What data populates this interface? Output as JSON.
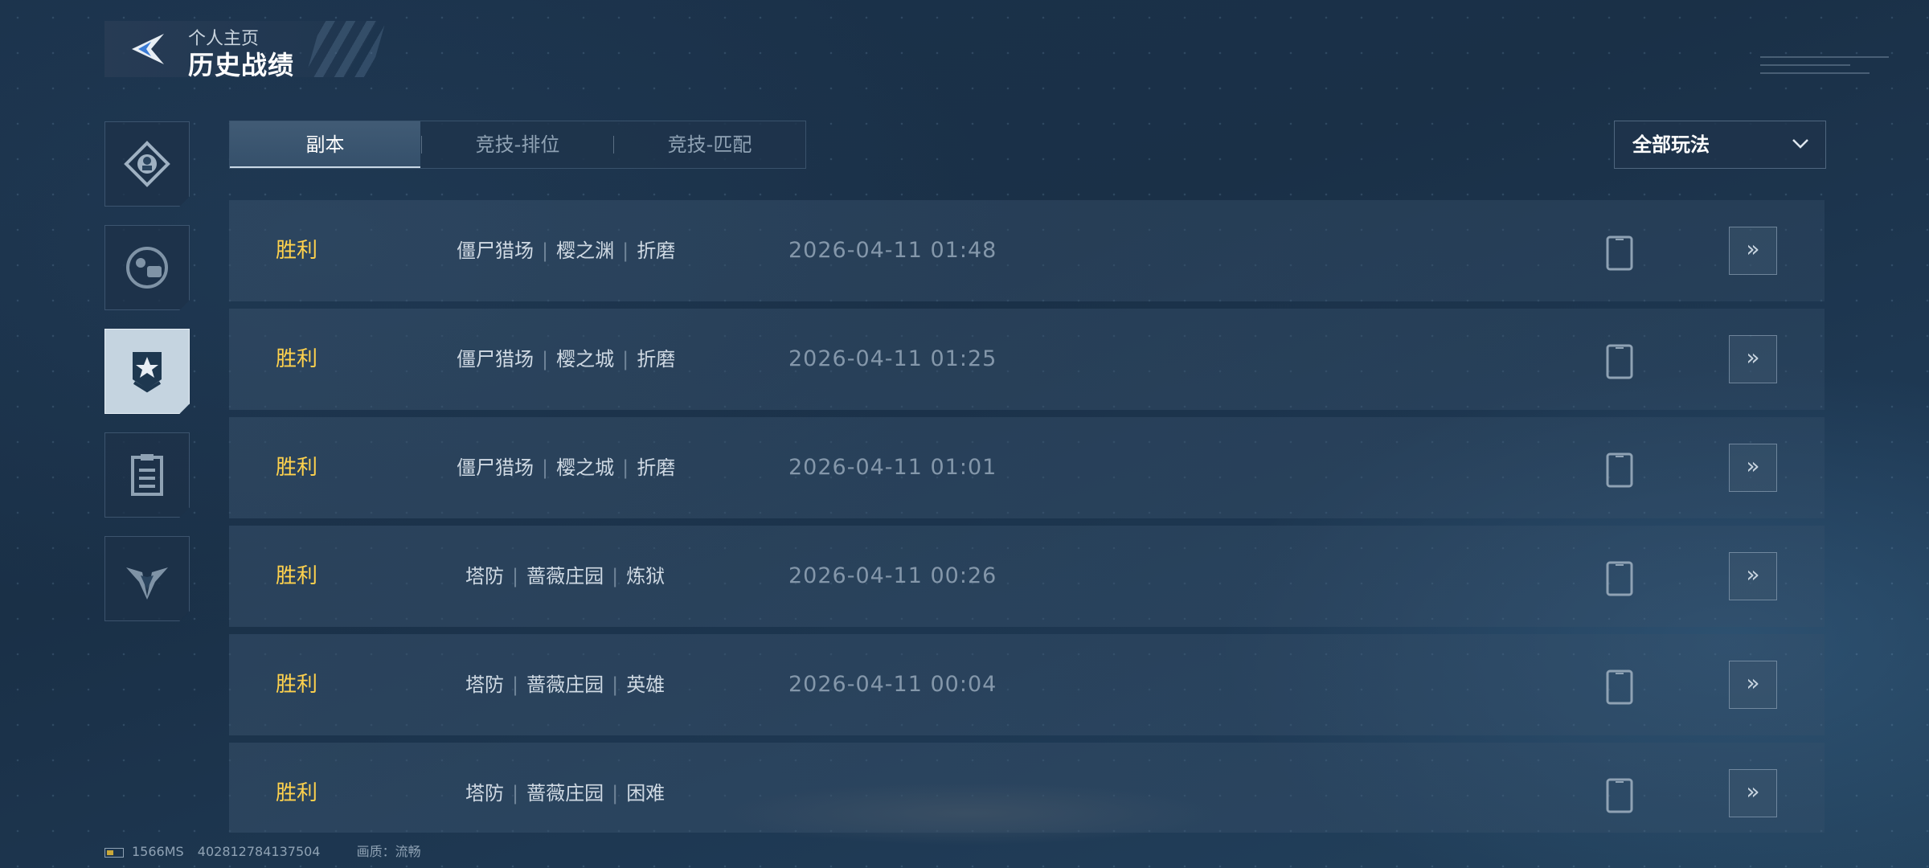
{
  "header": {
    "breadcrumb": "个人主页",
    "title": "历史战绩"
  },
  "sidebar": {
    "items": [
      {
        "icon": "profile-badge-icon",
        "active": false
      },
      {
        "icon": "team-icon",
        "active": false
      },
      {
        "icon": "rank-star-icon",
        "active": true
      },
      {
        "icon": "clipboard-icon",
        "active": false
      },
      {
        "icon": "emblem-icon",
        "active": false
      }
    ]
  },
  "tabs": [
    {
      "label": "副本",
      "active": true
    },
    {
      "label": "竞技-排位",
      "active": false
    },
    {
      "label": "竞技-匹配",
      "active": false
    }
  ],
  "filter": {
    "label": "全部玩法"
  },
  "records": [
    {
      "result": "胜利",
      "mode": "僵尸猎场",
      "map": "樱之渊",
      "difficulty": "折磨",
      "time": "2026-04-11 01:48"
    },
    {
      "result": "胜利",
      "mode": "僵尸猎场",
      "map": "樱之城",
      "difficulty": "折磨",
      "time": "2026-04-11 01:25"
    },
    {
      "result": "胜利",
      "mode": "僵尸猎场",
      "map": "樱之城",
      "difficulty": "折磨",
      "time": "2026-04-11 01:01"
    },
    {
      "result": "胜利",
      "mode": "塔防",
      "map": "蔷薇庄园",
      "difficulty": "炼狱",
      "time": "2026-04-11 00:26"
    },
    {
      "result": "胜利",
      "mode": "塔防",
      "map": "蔷薇庄园",
      "difficulty": "英雄",
      "time": "2026-04-11 00:04"
    },
    {
      "result": "胜利",
      "mode": "塔防",
      "map": "蔷薇庄园",
      "difficulty": "困难",
      "time": ""
    }
  ],
  "footer": {
    "ping": "1566MS",
    "uid": "402812784137504",
    "quality": "画质：流畅"
  },
  "colors": {
    "victory": "#ffd24d",
    "accent": "#3a7bd5"
  }
}
